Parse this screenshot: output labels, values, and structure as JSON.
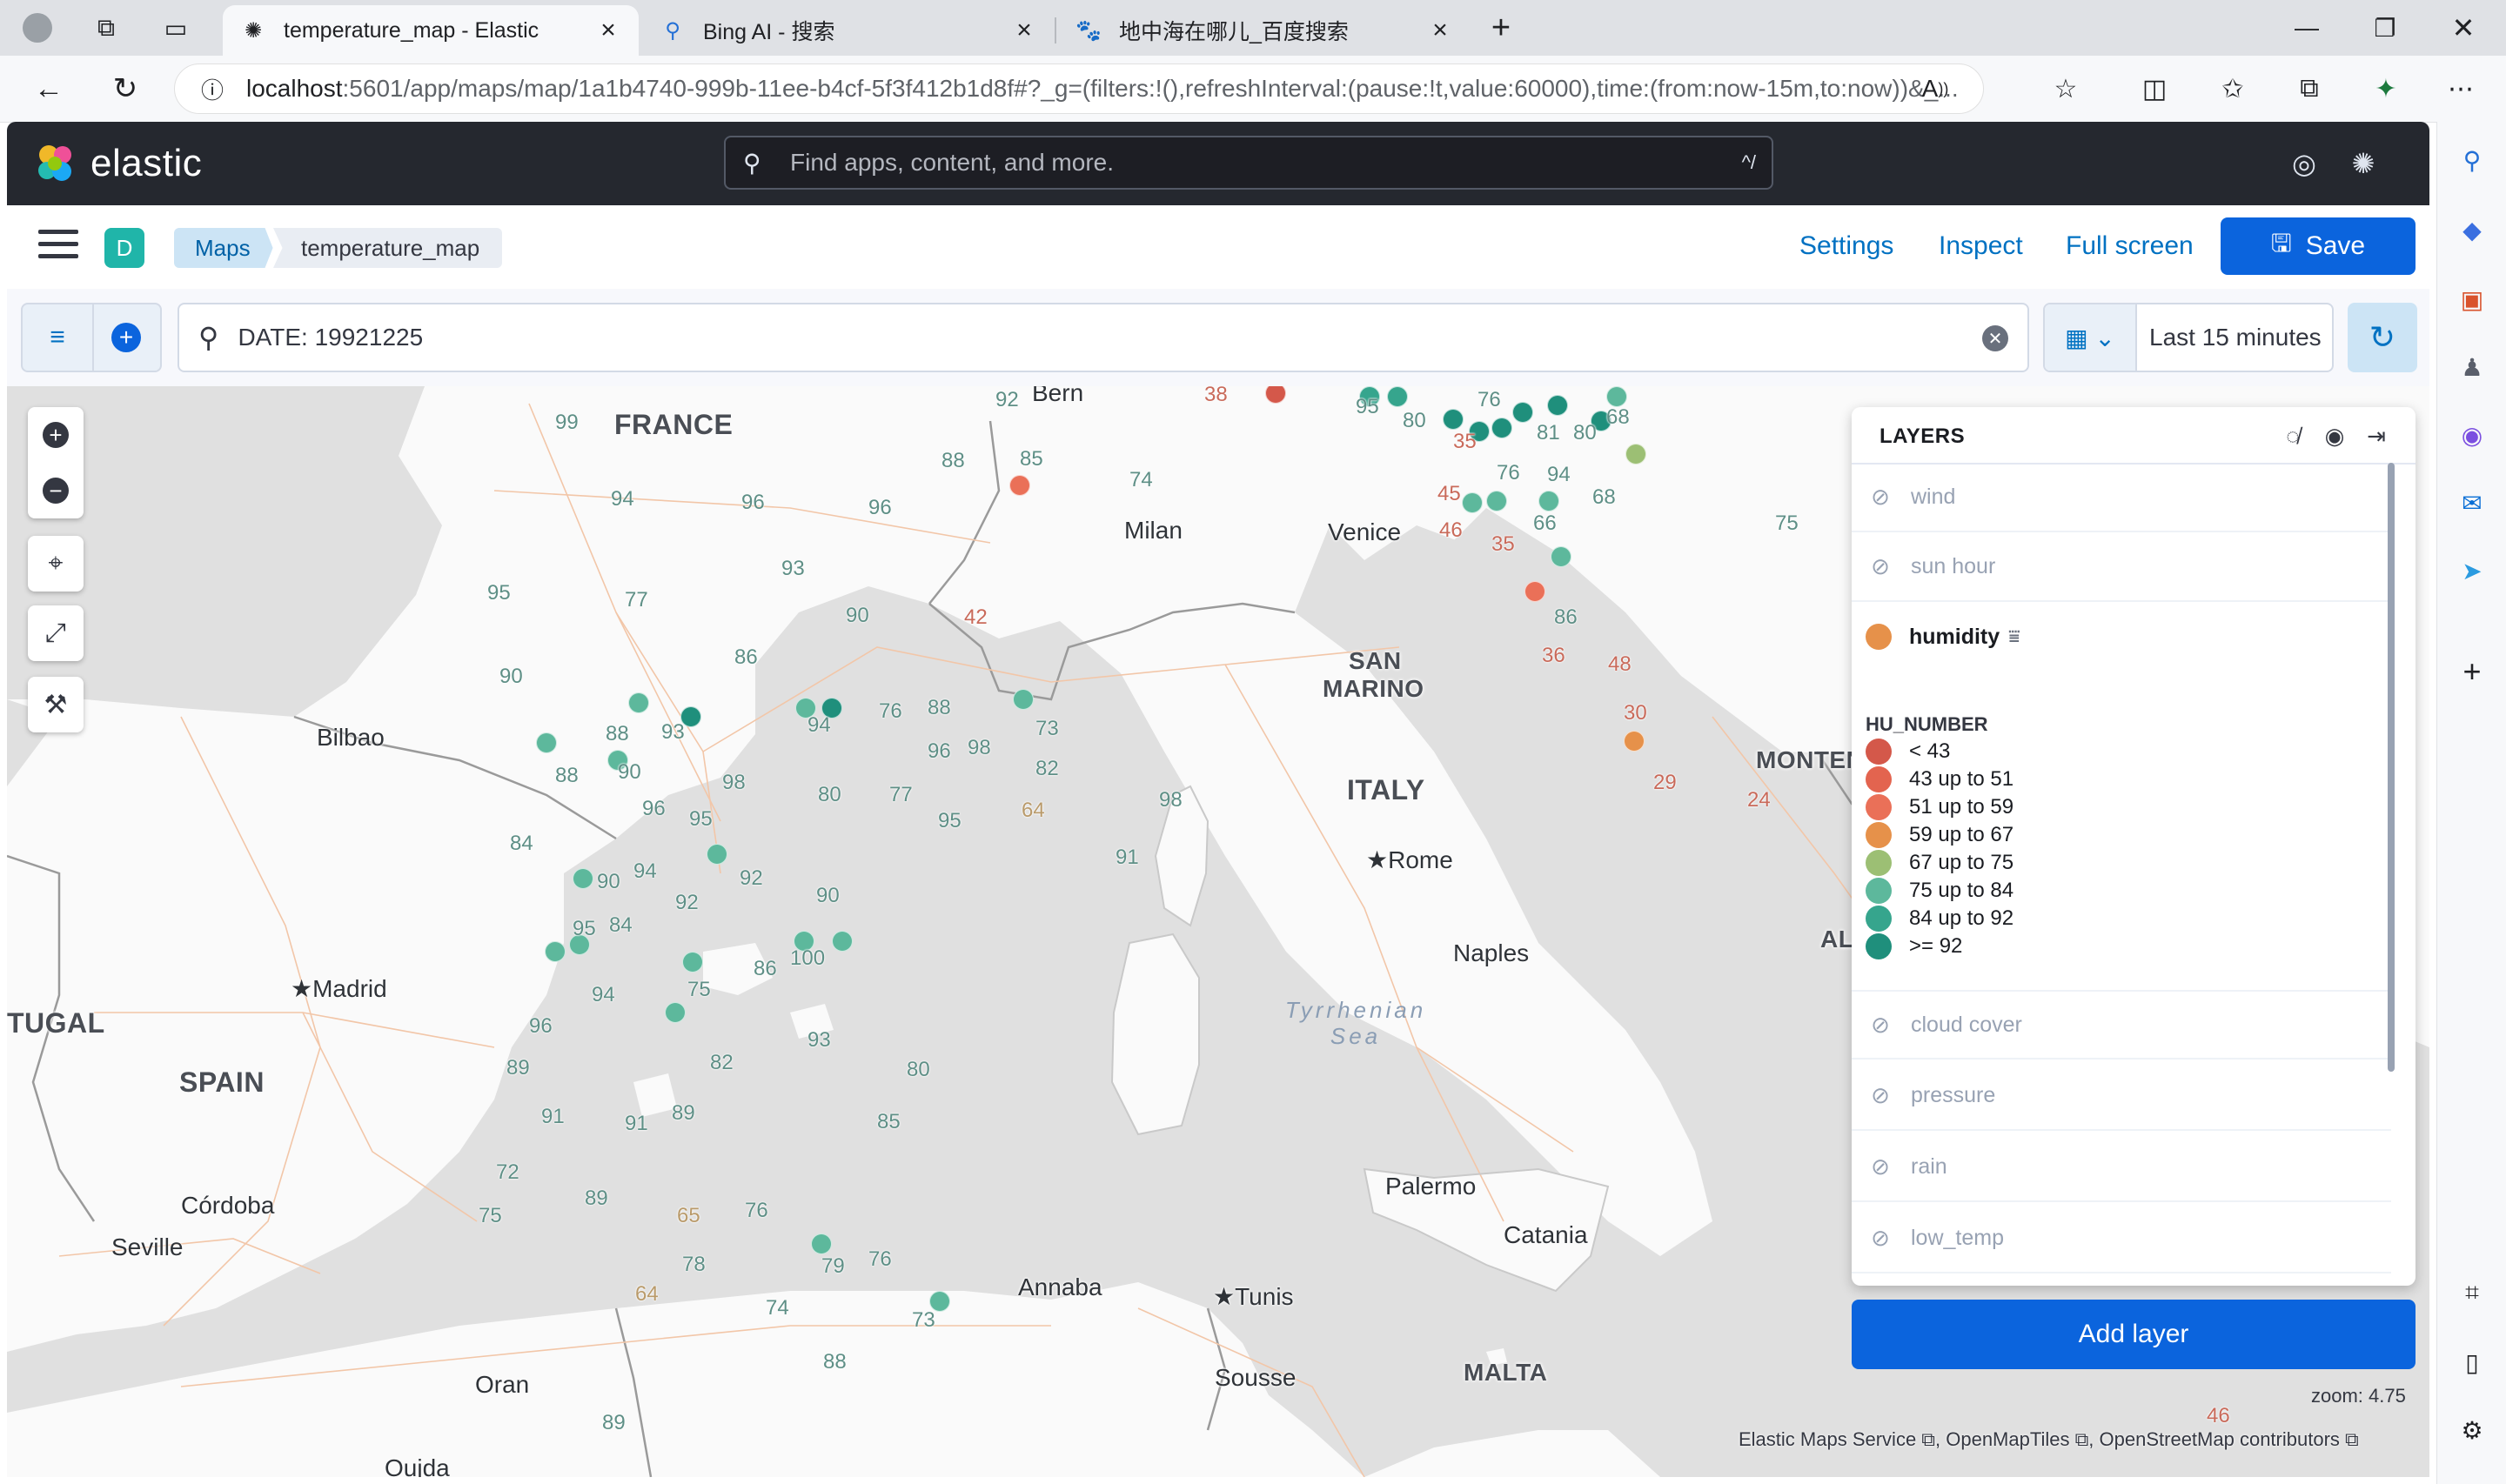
{
  "browser": {
    "tabs": [
      {
        "title": "temperature_map - Elastic",
        "icon": "elastic-favicon-icon"
      },
      {
        "title": "Bing AI - 搜索",
        "icon": "search-icon"
      },
      {
        "title": "地中海在哪儿_百度搜索",
        "icon": "baidu-icon"
      }
    ],
    "url_host": "localhost",
    "url_rest": ":5601/app/maps/map/1a1b4740-999b-11ee-b4cf-5f3f412b1d8f#?_g=(filters:!(),refreshInterval:(pause:!t,value:60000),time:(from:now-15m,to:now))&_..."
  },
  "kibana": {
    "brand": "elastic",
    "search_placeholder": "Find apps, content, and more.",
    "search_shortcut": "^/",
    "space_initial": "D",
    "breadcrumbs": [
      "Maps",
      "temperature_map"
    ],
    "links": {
      "settings": "Settings",
      "inspect": "Inspect",
      "fullscreen": "Full screen"
    },
    "save_label": "Save",
    "query": "DATE: 19921225",
    "time_range": "Last 15 minutes"
  },
  "map": {
    "cities": [
      "Bern",
      "Milan",
      "Venice",
      "SAN",
      "MARINO",
      "Bilbao",
      "Madrid",
      "Rome",
      "Naples",
      "Palermo",
      "Catania",
      "Annaba",
      "Tunis",
      "Sousse",
      "Oran",
      "Oujda",
      "Seville",
      "Córdoba",
      "MALTA"
    ],
    "countries": [
      "FRANCE",
      "SPAIN",
      "ITALY",
      "MONTEN",
      "TUGAL",
      "AL"
    ],
    "seas": [
      "Tyrrhenian",
      "Sea"
    ],
    "zoom": "zoom: 4.75",
    "attribution": [
      "Elastic Maps Service",
      "OpenMapTiles",
      "OpenStreetMap contributors"
    ]
  },
  "layers": {
    "title": "LAYERS",
    "rows_top": [
      "wind",
      "sun hour"
    ],
    "active_layer": "humidity",
    "legend_title": "HU_NUMBER",
    "legend": [
      {
        "label": "< 43",
        "color": "#d4584a"
      },
      {
        "label": "43 up to 51",
        "color": "#e3644f"
      },
      {
        "label": "51 up to 59",
        "color": "#ea7058"
      },
      {
        "label": "59 up to 67",
        "color": "#e6914a"
      },
      {
        "label": "67 up to 75",
        "color": "#9cbf74"
      },
      {
        "label": "75 up to 84",
        "color": "#5db89c"
      },
      {
        "label": "84 up to 92",
        "color": "#36a58d"
      },
      {
        "label": ">= 92",
        "color": "#1f8f7c"
      }
    ],
    "rows_bottom": [
      "cloud cover",
      "pressure",
      "rain",
      "low_temp"
    ],
    "add_label": "Add layer"
  }
}
